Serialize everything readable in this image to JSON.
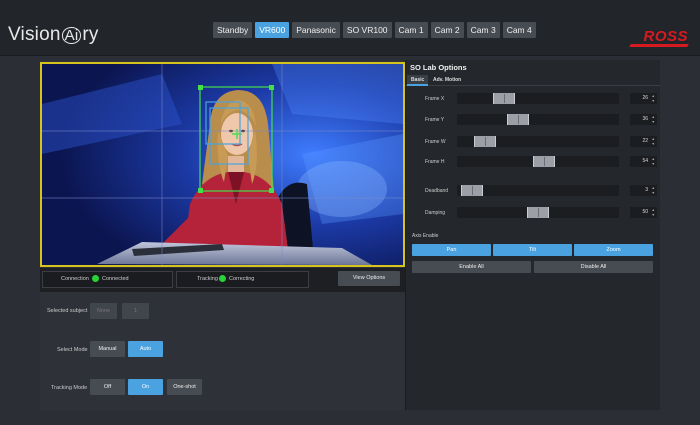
{
  "header": {
    "logo_text_pre": "Vision",
    "logo_text_ai": "Ai",
    "logo_text_post": "ry",
    "brand": "ROSS",
    "camera_tabs": [
      {
        "label": "Standby",
        "active": false
      },
      {
        "label": "VR600",
        "active": true
      },
      {
        "label": "Panasonic",
        "active": false
      },
      {
        "label": "SO VR100",
        "active": false
      },
      {
        "label": "Cam 1",
        "active": false
      },
      {
        "label": "Cam 2",
        "active": false
      },
      {
        "label": "Cam 3",
        "active": false
      },
      {
        "label": "Cam 4",
        "active": false
      }
    ]
  },
  "status": {
    "connection_label": "Connection",
    "connection_value": "Connected",
    "tracking_label": "Tracking",
    "tracking_value": "Correcting",
    "view_options_label": "View Options"
  },
  "controls": {
    "selected_subject_label": "Selected subject",
    "subject_options": [
      "None",
      "1"
    ],
    "select_mode_label": "Select Mode",
    "select_mode_options": [
      "Manual",
      "Auto"
    ],
    "select_mode_active": "Auto",
    "tracking_mode_label": "Tracking Mode",
    "tracking_mode_options": [
      "Off",
      "On",
      "One-shot"
    ],
    "tracking_mode_active": "On"
  },
  "options": {
    "title": "SO Lab Options",
    "tabs": [
      {
        "label": "Basic",
        "active": true
      },
      {
        "label": "Adv. Motion",
        "active": false
      }
    ],
    "params": [
      {
        "label": "Frame X",
        "value": "26",
        "fraction": 0.26
      },
      {
        "label": "Frame Y",
        "value": "36",
        "fraction": 0.36
      },
      {
        "label": "Frame W",
        "value": "22",
        "fraction": 0.12
      },
      {
        "label": "Frame H",
        "value": "54",
        "fraction": 0.54
      },
      {
        "label": "Deadband",
        "value": "3",
        "fraction": 0.03
      },
      {
        "label": "Damping",
        "value": "50",
        "fraction": 0.5
      }
    ],
    "axis_enable_label": "Axis Enable",
    "axis_buttons": [
      "Pan",
      "Tilt",
      "Zoom"
    ],
    "enable_all_label": "Enable All",
    "disable_all_label": "Disable All"
  },
  "colors": {
    "accent": "#4aa3e0",
    "video_border": "#d6c31c",
    "status_ok": "#2ad13a",
    "brand": "#d71920"
  }
}
